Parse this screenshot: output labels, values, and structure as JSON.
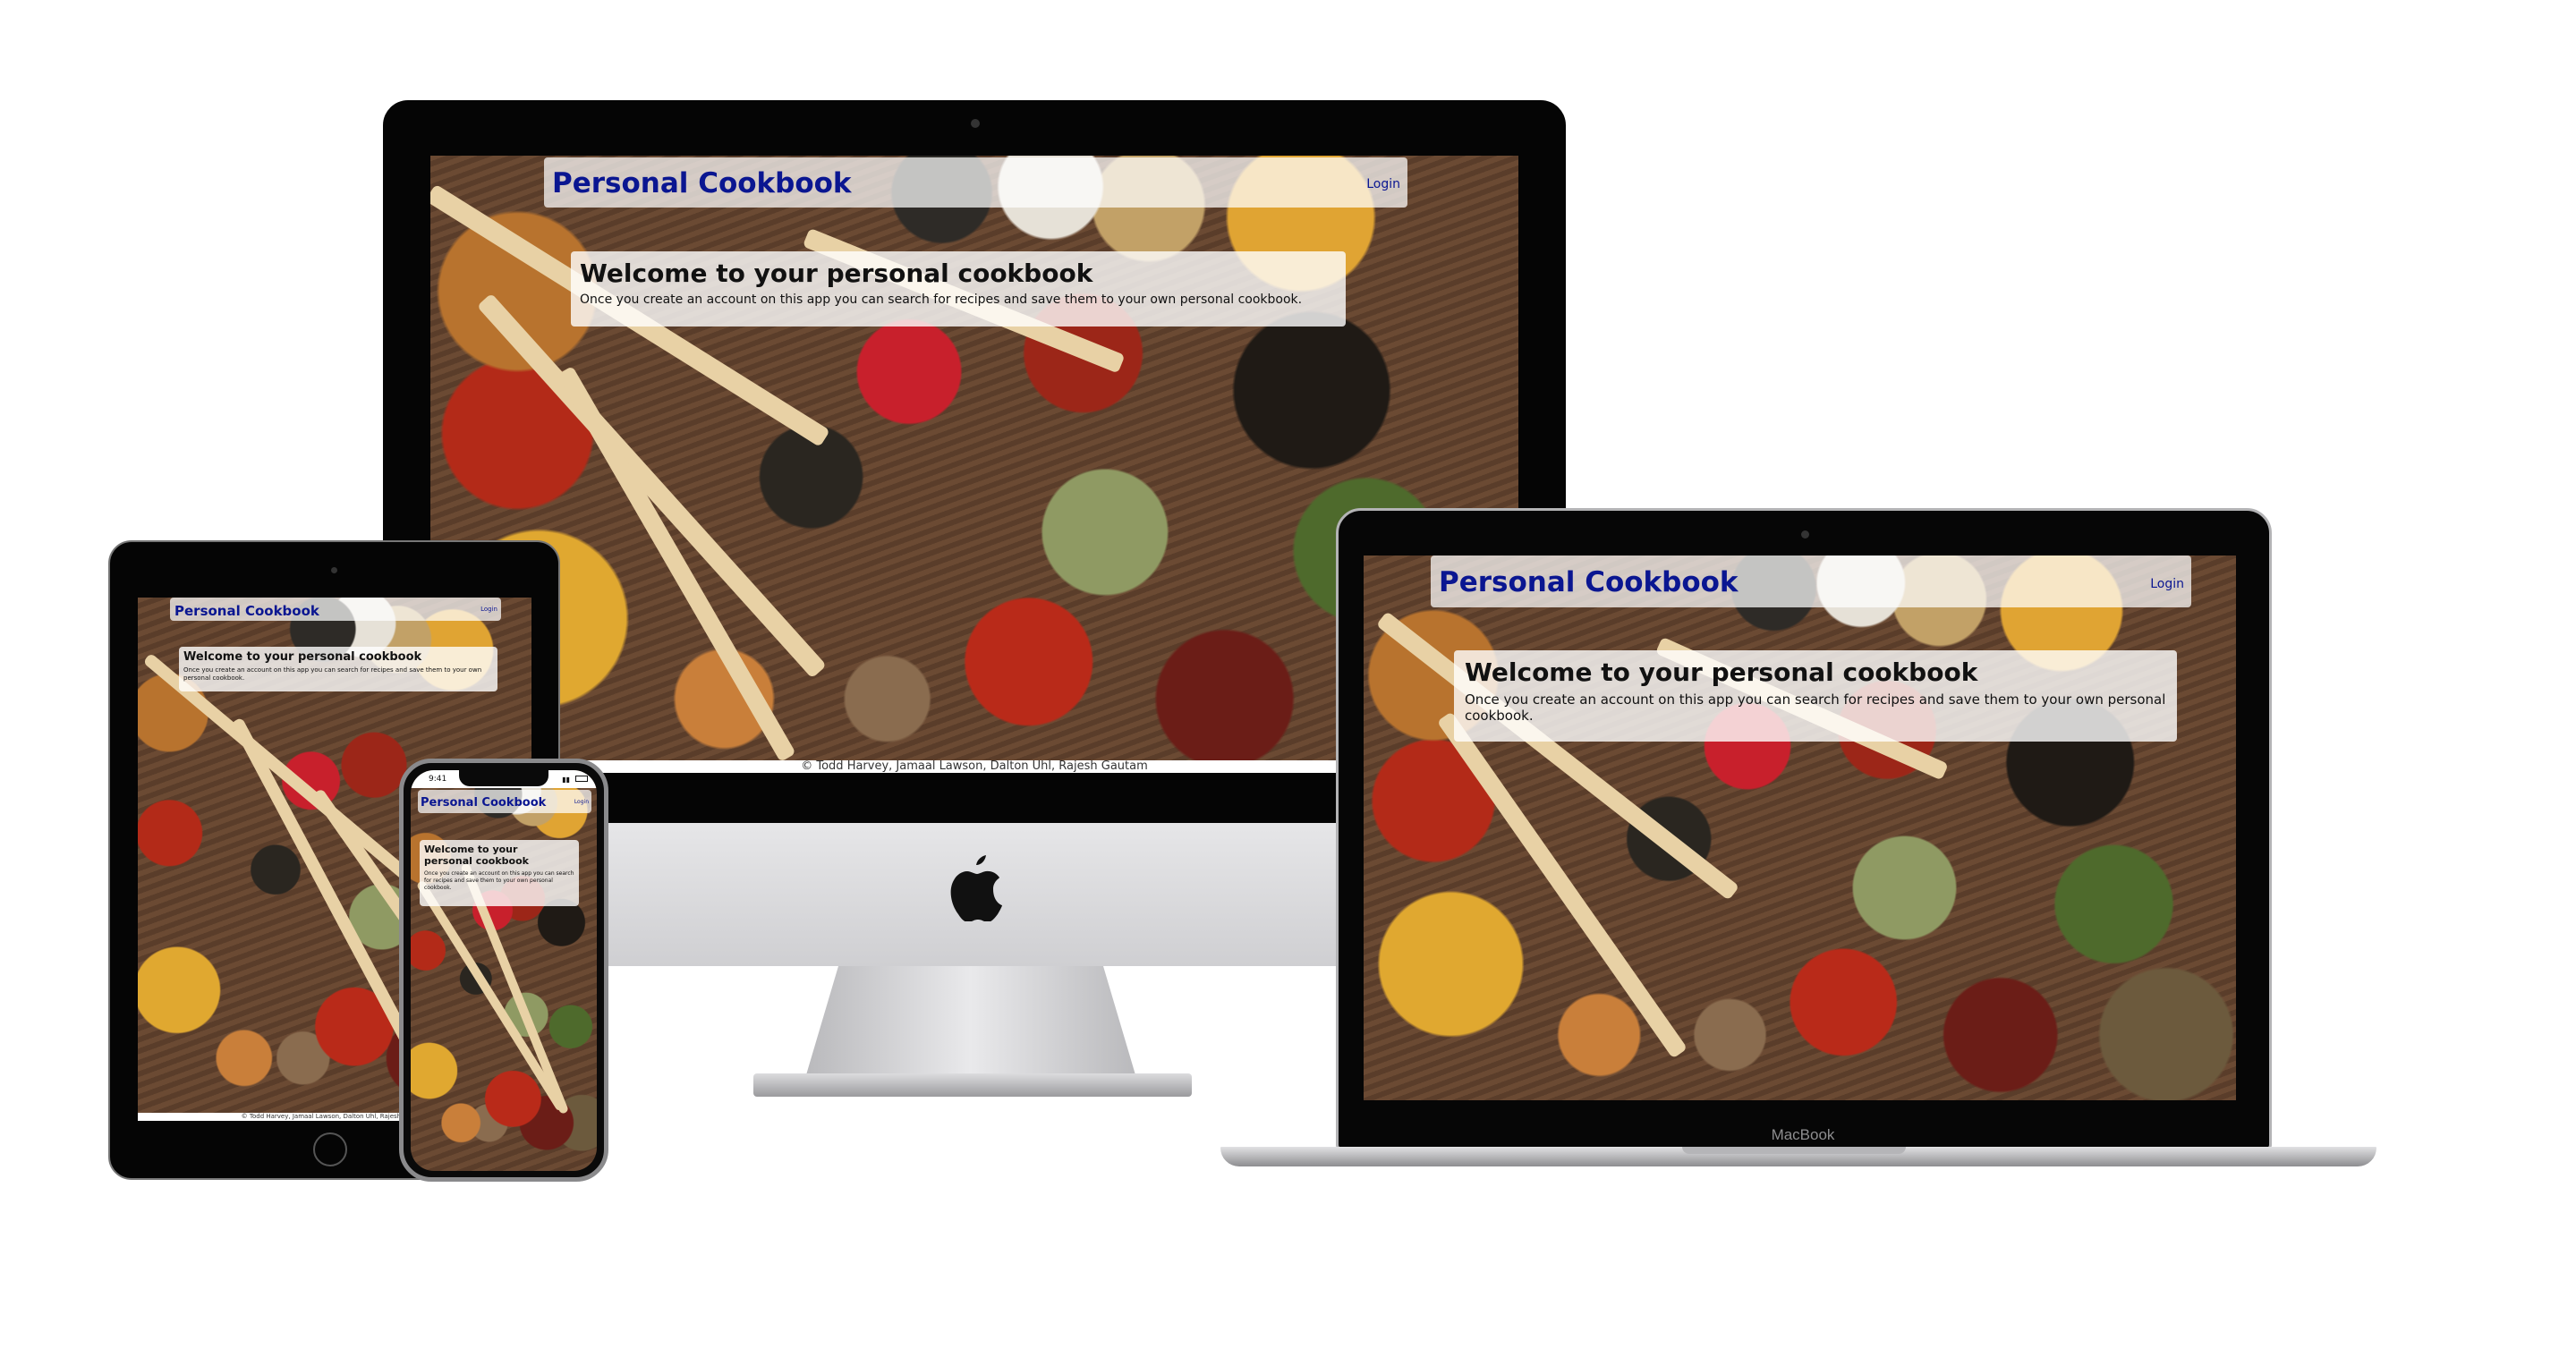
{
  "app": {
    "title": "Personal Cookbook",
    "login_label": "Login",
    "hero": {
      "heading": "Welcome to your personal cookbook",
      "text": "Once you create an account on this app you can search for recipes and save them to your own personal cookbook."
    },
    "footer": "© Todd Harvey, Jamaal Lawson, Dalton Uhl, Rajesh Gautam"
  },
  "devices": {
    "laptop_brand": "MacBook",
    "phone_time": "9:41"
  },
  "colors": {
    "title": "#0a1691",
    "device_frame": "#000000",
    "imac_chin": "#d7d7d9"
  }
}
